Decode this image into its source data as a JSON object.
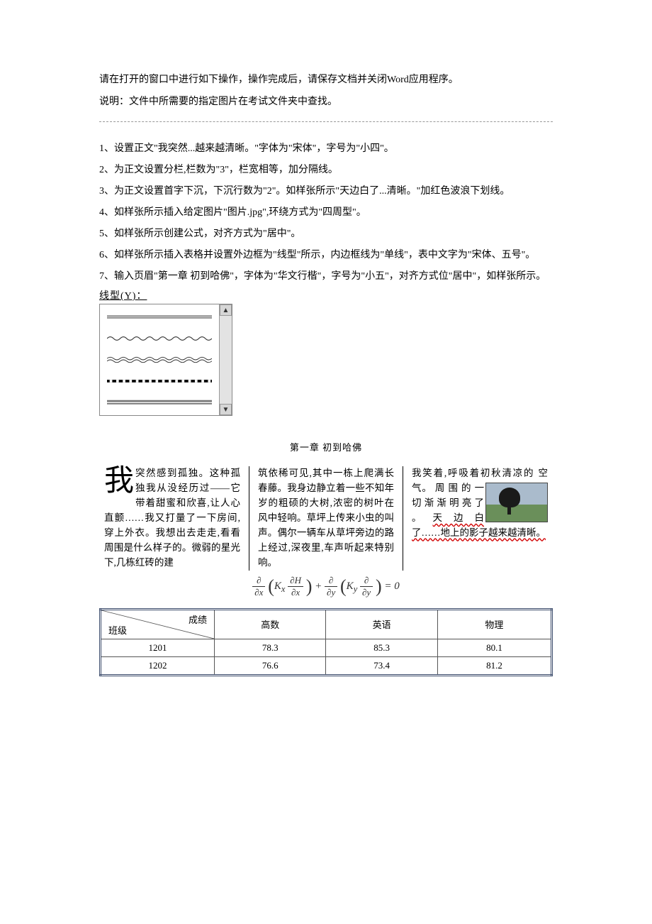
{
  "intro": {
    "line1": "请在打开的窗口中进行如下操作，操作完成后，请保存文档并关闭Word应用程序。",
    "line2": "说明：文件中所需要的指定图片在考试文件夹中查找。"
  },
  "rules": [
    "1、设置正文\"我突然...越来越清晰。\"字体为\"宋体\"，字号为\"小四\"。",
    "2、为正文设置分栏,栏数为\"3\"，栏宽相等，加分隔线。",
    "3、为正文设置首字下沉，下沉行数为\"2\"。如样张所示\"天边白了...清晰。\"加红色波浪下划线。",
    "4、如样张所示插入给定图片\"图片.jpg\",环绕方式为\"四周型\"。",
    "5、如样张所示创建公式，对齐方式为\"居中\"。",
    "6、如样张所示插入表格并设置外边框为\"线型\"所示，内边框线为\"单线\"，表中文字为\"宋体、五号\"。",
    "7、输入页眉\"第一章 初到哈佛\"，字体为\"华文行楷\"，字号为\"小五\"，对齐方式位\"居中\"，如样张所示。"
  ],
  "lineTypeLabel": "线型(Y)：",
  "sample": {
    "header": "第一章 初到哈佛",
    "dropcap": "我",
    "col1": "突然感到孤独。这种孤独我从没经历过——它带着甜蜜和欣喜,让人心直颤……我又打量了一下房间,穿上外衣。我想出去走走,看看周围是什么样子的。微弱的星光下,几栋红砖的建",
    "col2": "筑依稀可见,其中一栋上爬满长春藤。我身边静立着一些不知年岁的粗硕的大树,浓密的树叶在风中轻响。草坪上传来小虫的叫声。偶尔一辆车从草坪旁边的路上经过,深夜里,车声听起来特别响。",
    "col3a": "我笑着,呼吸着初秋清凉的",
    "col3b_words": [
      "空",
      "气。",
      "周",
      "围",
      "的",
      "一",
      "切"
    ],
    "col3c": "渐 渐 明 亮 了 。",
    "col3d": "天 边 白了……地上的影子越来越清晰。",
    "formula_text": "∂/∂x (Kx ∂H/∂x) + ∂/∂y (Ky ∂/∂y) = 0"
  },
  "chart_data": {
    "type": "table",
    "diag_top": "成绩",
    "diag_bottom": "班级",
    "columns": [
      "高数",
      "英语",
      "物理"
    ],
    "rows": [
      {
        "class": "1201",
        "values": [
          78.3,
          85.3,
          80.1
        ]
      },
      {
        "class": "1202",
        "values": [
          76.6,
          73.4,
          81.2
        ]
      }
    ]
  }
}
